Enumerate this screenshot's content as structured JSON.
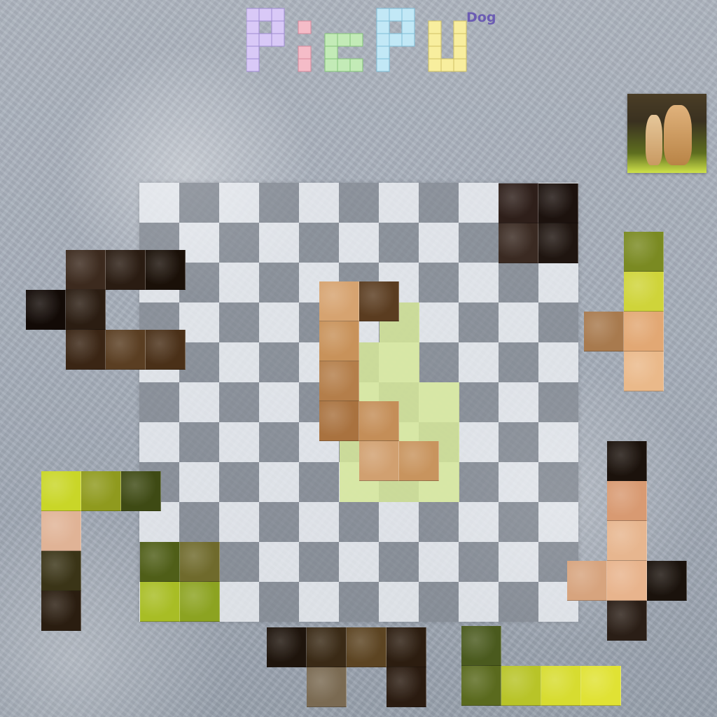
{
  "game": {
    "title": "PicPu",
    "subtitle": "Dog",
    "board": {
      "rows": 11,
      "cols": 11
    }
  },
  "preview": {
    "icon": "dog-preview-image"
  },
  "palette": {
    "logo_letters": [
      "#d7c6f6",
      "#f3b9c5",
      "#bfe8b5",
      "#bfe6f5",
      "#f7ec9a"
    ],
    "board_light": "#eef0f4",
    "board_dark": "#80868f",
    "hint": "#d6e79a"
  },
  "pieces": [
    {
      "id": "top-right-dark",
      "color": "#2a1c17"
    },
    {
      "id": "left-dark-c",
      "color": "#2d1b12"
    },
    {
      "id": "center-dog-body",
      "color": "#c9955c"
    },
    {
      "id": "right-grass-fur",
      "color": "#e3b27a"
    },
    {
      "id": "left-grass-l",
      "color": "#bcca2a"
    },
    {
      "id": "bottom-left-grass",
      "color": "#6f7a1c"
    },
    {
      "id": "right-dog-face",
      "color": "#e8b48d"
    },
    {
      "id": "bottom-dark-t",
      "color": "#24170f"
    },
    {
      "id": "bottom-grass-l",
      "color": "#c8d42b"
    }
  ]
}
